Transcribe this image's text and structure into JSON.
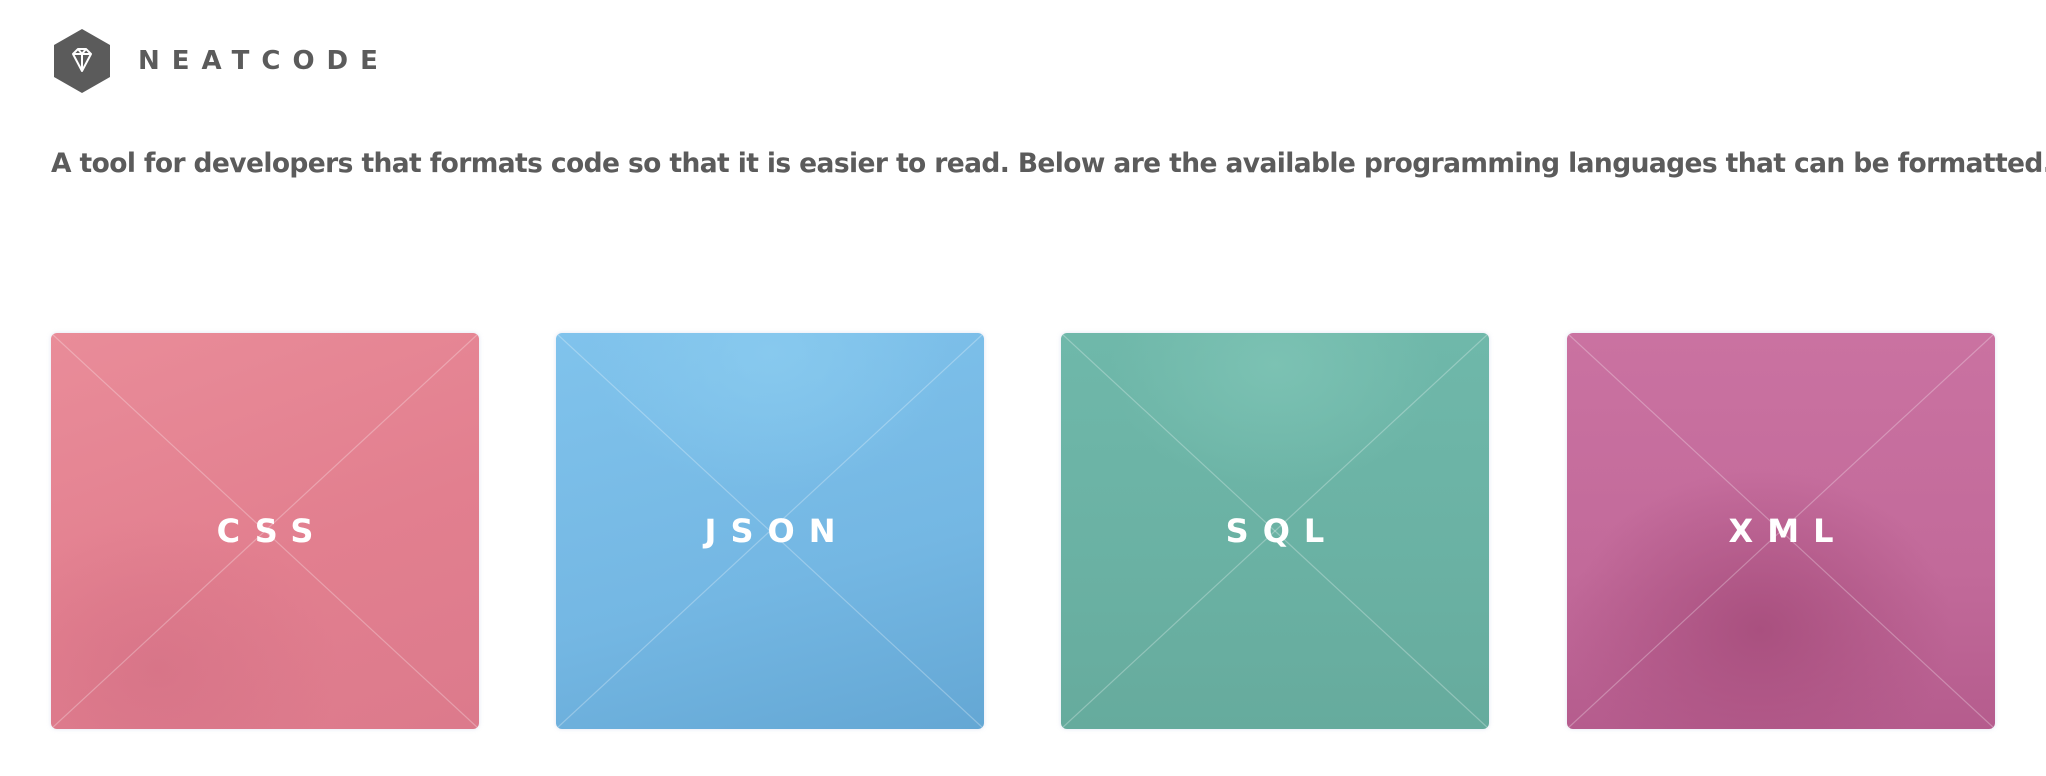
{
  "brand": {
    "name": "NEATCODE",
    "logo_icon": "diamond-hexagon-icon"
  },
  "tagline": "A tool for developers that formats code so that it is easier to read. Below are the available programming languages that can be formatted.",
  "languages": [
    {
      "label": "CSS",
      "color": "#e4828f"
    },
    {
      "label": "JSON",
      "color": "#74b7e3"
    },
    {
      "label": "SQL",
      "color": "#6ab1a3"
    },
    {
      "label": "XML",
      "color": "#c46b9b"
    }
  ],
  "colors": {
    "text": "#5b5b5b",
    "background": "#ffffff"
  }
}
